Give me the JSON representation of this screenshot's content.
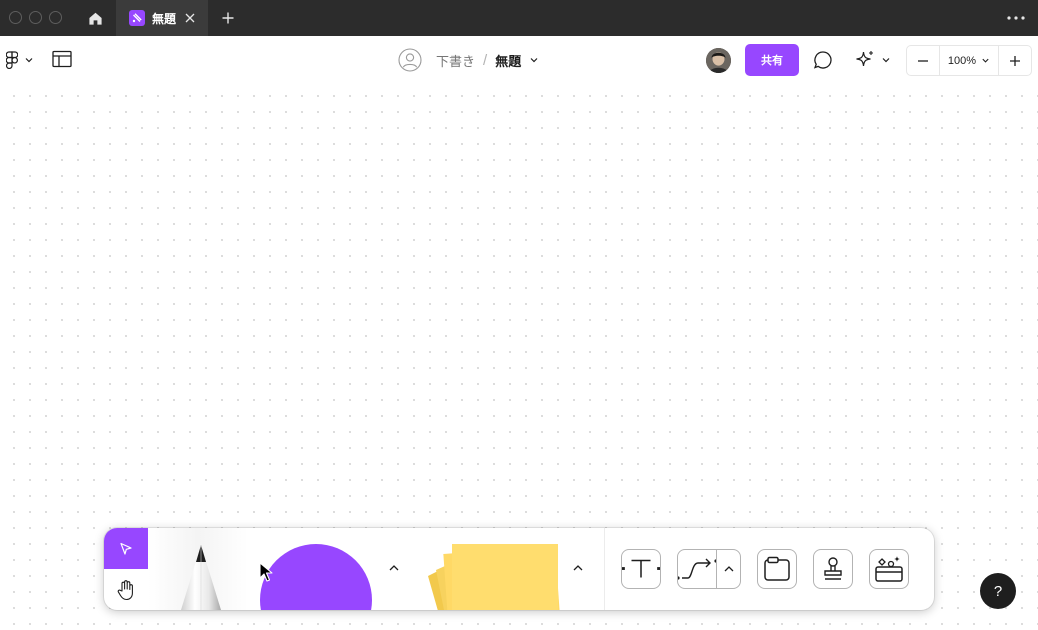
{
  "titlebar": {
    "tab": {
      "title": "無題",
      "icon": "figjam-file-icon",
      "close_icon": "close-icon"
    },
    "home_icon": "home-icon",
    "new_tab_icon": "plus-icon",
    "more_icon": "more-horizontal-icon"
  },
  "header": {
    "main_menu_icon": "figma-logo-icon",
    "layout_icon": "layout-panel-icon",
    "draft_label": "下書き",
    "separator": "/",
    "file_name": "無題",
    "share_label": "共有",
    "comment_icon": "comment-icon",
    "ai_icon": "sparkle-icon",
    "zoom": {
      "value": "100%",
      "out_icon": "minus-icon",
      "in_icon": "plus-icon"
    }
  },
  "dock": {
    "tools": [
      "move-tool",
      "hand-tool",
      "marker-tool",
      "shape-tool",
      "sticky-note-tool",
      "text-tool",
      "connector-tool",
      "section-tool",
      "stamp-tool",
      "more-tools"
    ],
    "selected_tool": "move-tool",
    "colors": {
      "accent": "#9747ff",
      "sticky": "#ffd966"
    }
  },
  "help_label": "?",
  "colors": {
    "titlebar": "#2c2c2c",
    "accent": "#9747ff"
  }
}
